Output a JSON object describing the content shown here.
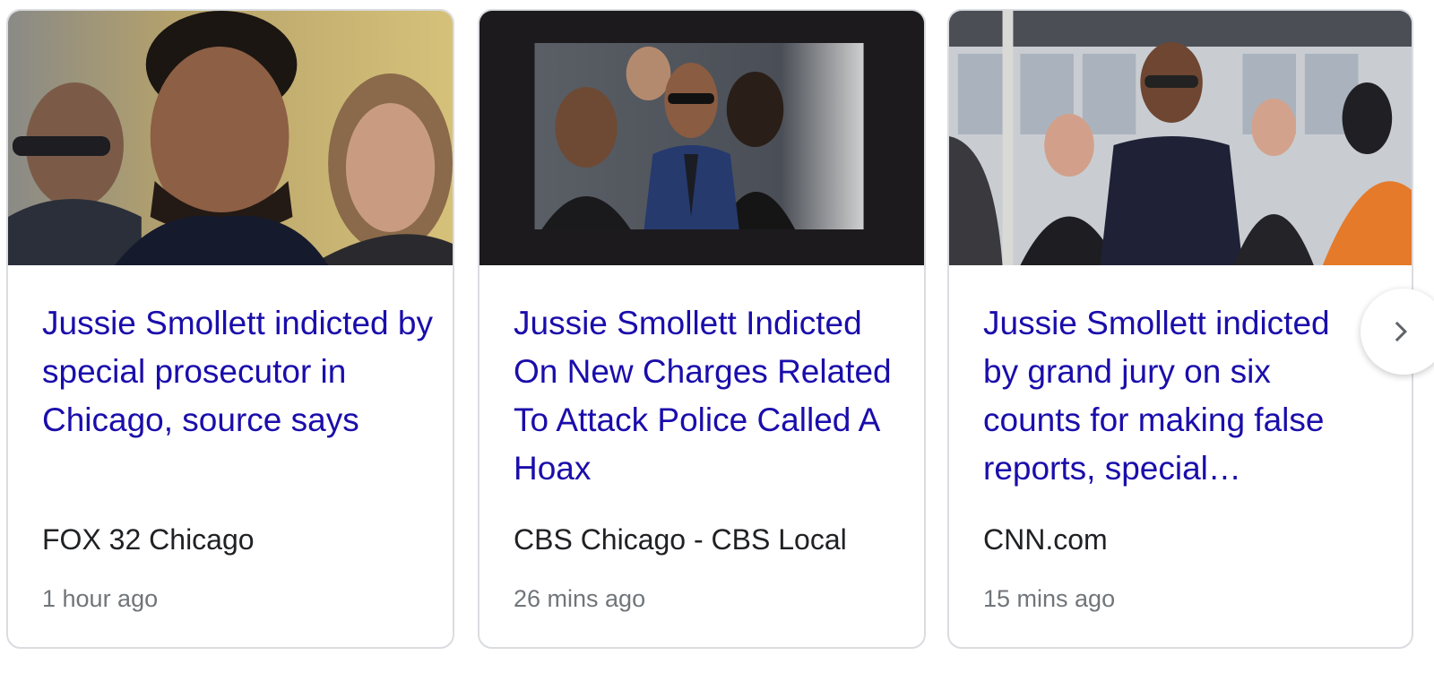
{
  "news_carousel": {
    "cards": [
      {
        "headline": "Jussie Smollett indicted by special prosecutor in Chicago, source says",
        "source": "FOX 32 Chicago",
        "time": "1 hour ago",
        "image": "photo-smollett-closeup"
      },
      {
        "headline": "Jussie Smollett Indicted On New Charges Related To Attack Police Called A Hoax",
        "source": "CBS Chicago - CBS Local",
        "time": "26 mins ago",
        "image": "photo-smollett-walking-group"
      },
      {
        "headline": "Jussie Smollett indicted by grand jury on six counts for making false reports, special…",
        "source": "CNN.com",
        "time": "15 mins ago",
        "image": "photo-smollett-courthouse"
      }
    ],
    "next_icon": "chevron-right-icon",
    "colors": {
      "headline": "#1a0dab",
      "source": "#202124",
      "time": "#70757a",
      "card_border": "#dadce0"
    }
  }
}
